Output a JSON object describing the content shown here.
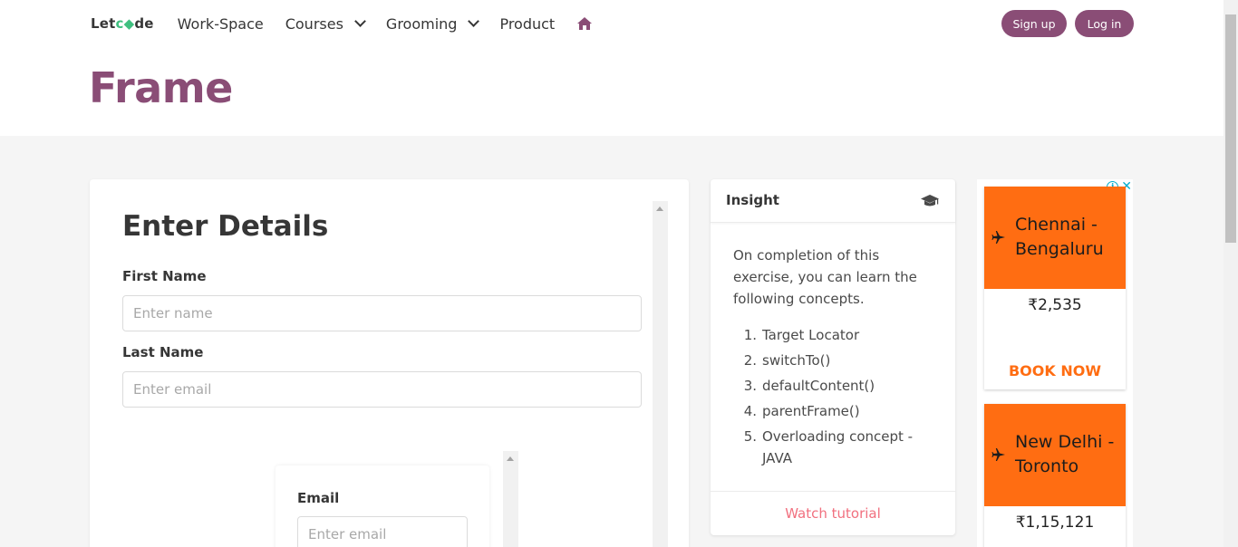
{
  "nav": {
    "logo_pre": "Let",
    "logo_o": "c",
    "logo_post": "de",
    "items": [
      {
        "label": "Work-Space"
      },
      {
        "label": "Courses"
      },
      {
        "label": "Grooming"
      },
      {
        "label": "Product"
      }
    ],
    "signup_label": "Sign up",
    "login_label": "Log in"
  },
  "page": {
    "title": "Frame"
  },
  "form": {
    "title": "Enter Details",
    "first_name_label": "First Name",
    "first_name_placeholder": "Enter name",
    "last_name_label": "Last Name",
    "last_name_placeholder": "Enter email",
    "inner": {
      "email_label": "Email",
      "email_placeholder": "Enter email"
    }
  },
  "insight": {
    "title": "Insight",
    "description": "On completion of this exercise, you can learn the following concepts.",
    "items": [
      "Target Locator",
      "switchTo()",
      "defaultContent()",
      "parentFrame()",
      "Overloading concept - JAVA"
    ],
    "watch_label": "Watch tutorial"
  },
  "ads": [
    {
      "route": "Chennai - Bengaluru",
      "price": "₹2,535",
      "cta": "BOOK NOW"
    },
    {
      "route": "New Delhi - Toronto",
      "price": "₹1,15,121"
    }
  ],
  "colors": {
    "brand": "#8a4d76",
    "ad_orange": "#ff6d12",
    "watch_link": "#f1707f",
    "logo_accent": "#3fbf7f"
  },
  "icons": {
    "home": "home-icon",
    "insight": "graduation-cap-icon",
    "ad_plane": "airplane-icon"
  }
}
